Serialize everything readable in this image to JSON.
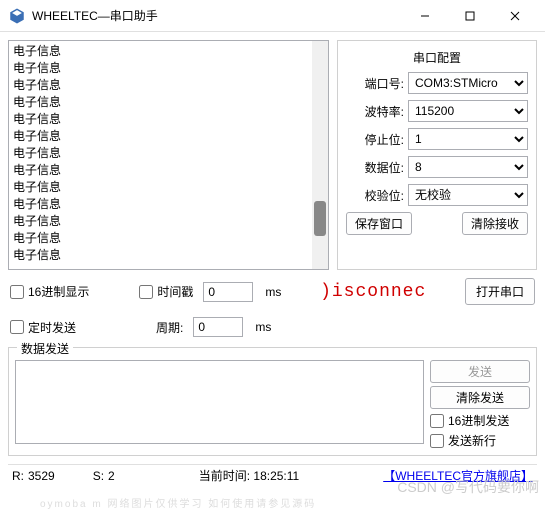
{
  "window": {
    "title": "WHEELTEC—串口助手"
  },
  "recv": {
    "line": "电子信息",
    "line_count": 13
  },
  "config": {
    "title": "串口配置",
    "port_label": "端口号:",
    "port_value": "COM3:STMicro",
    "baud_label": "波特率:",
    "baud_value": "115200",
    "stop_label": "停止位:",
    "stop_value": "1",
    "data_label": "数据位:",
    "data_value": "8",
    "parity_label": "校验位:",
    "parity_value": "无校验",
    "save_btn": "保存窗口",
    "clear_btn": "清除接收"
  },
  "opts": {
    "hex_display": "16进制显示",
    "timestamp": "时间戳",
    "timestamp_val": "0",
    "timestamp_unit": "ms",
    "timed_send": "定时发送",
    "period_label": "周期:",
    "period_val": "0",
    "period_unit": "ms",
    "status": ")isconnec",
    "open_btn": "打开串口"
  },
  "send": {
    "legend": "数据发送",
    "send_btn": "发送",
    "clear_btn": "清除发送",
    "hex_send": "16进制发送",
    "newline": "发送新行"
  },
  "status": {
    "r_label": "R:",
    "r_val": "3529",
    "s_label": "S:",
    "s_val": "2",
    "time_label": "当前时间:",
    "time_val": "18:25:11",
    "link": "【WHEELTEC官方旗舰店】"
  },
  "watermark": "CSDN @写代码要你啊",
  "watermark2": "oymoba m 网络图片仅供学习  如何使用请参见源码"
}
